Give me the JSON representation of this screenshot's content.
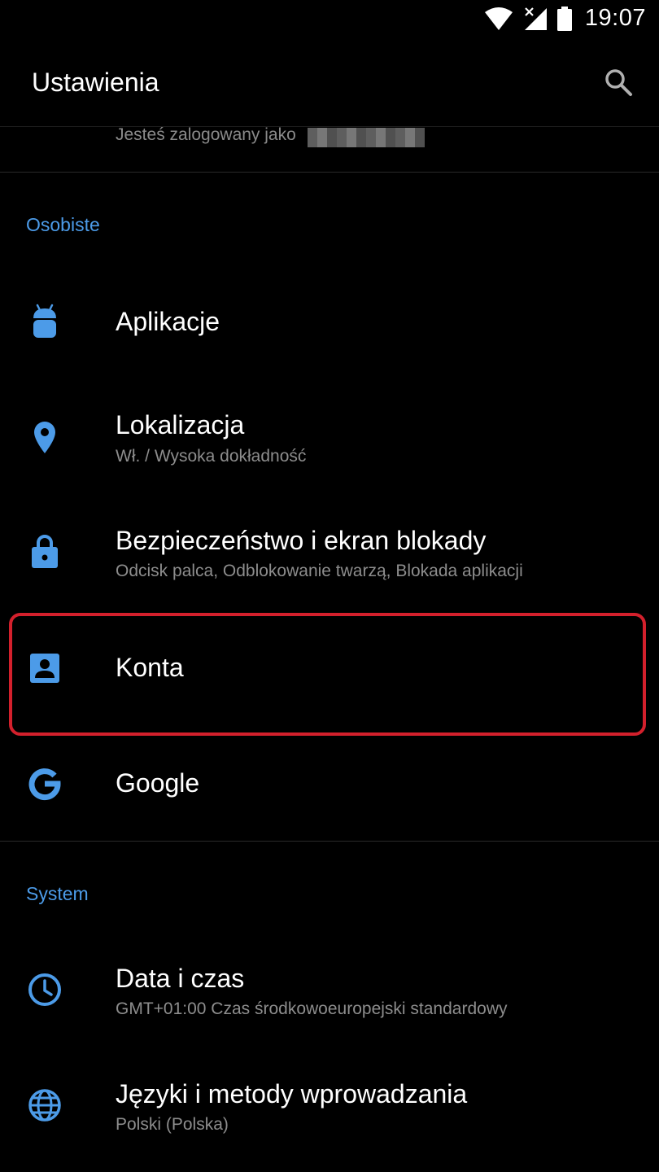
{
  "status_bar": {
    "time": "19:07",
    "icons": [
      "wifi-icon",
      "signal-icon",
      "battery-icon"
    ]
  },
  "app_bar": {
    "title": "Ustawienia",
    "search_icon": "search-icon"
  },
  "account": {
    "logged_in_text": "Jesteś zalogowany jako"
  },
  "sections": {
    "personal": {
      "header": "Osobiste"
    },
    "system": {
      "header": "System"
    }
  },
  "items": {
    "apps": {
      "title": "Aplikacje",
      "icon": "android-icon"
    },
    "location": {
      "title": "Lokalizacja",
      "subtitle": "Wł. / Wysoka dokładność",
      "icon": "location-pin-icon"
    },
    "security": {
      "title": "Bezpieczeństwo i ekran blokady",
      "subtitle": "Odcisk palca, Odblokowanie twarzą, Blokada aplikacji",
      "icon": "lock-icon"
    },
    "accounts": {
      "title": "Konta",
      "icon": "account-box-icon"
    },
    "google": {
      "title": "Google",
      "icon": "google-icon"
    },
    "datetime": {
      "title": "Data i czas",
      "subtitle": "GMT+01:00 Czas środkowoeuropejski standardowy",
      "icon": "clock-icon"
    },
    "languages": {
      "title": "Języki i metody wprowadzania",
      "subtitle": "Polski (Polska)",
      "icon": "globe-icon"
    }
  },
  "colors": {
    "accent": "#4c9be8",
    "highlight": "#d3202c",
    "background": "#000000"
  }
}
